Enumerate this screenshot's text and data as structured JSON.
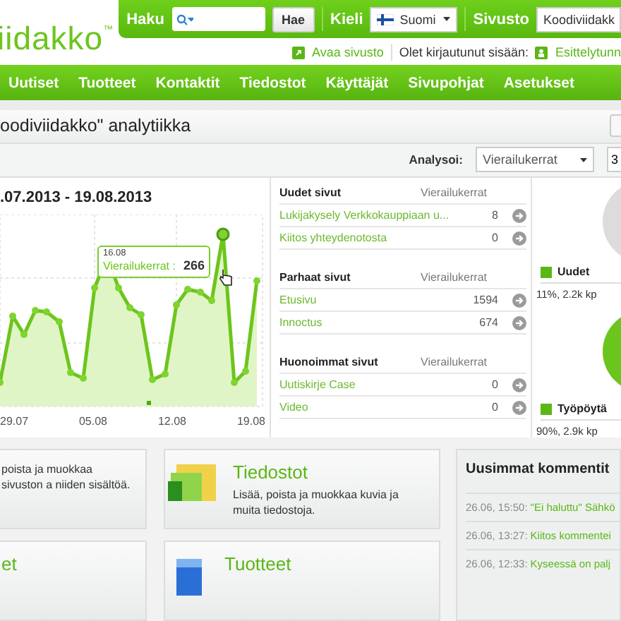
{
  "header": {
    "logo": "iidakko",
    "logo_mark": "™",
    "search_label": "Haku",
    "search_button": "Hae",
    "language_label": "Kieli",
    "language": "Suomi",
    "site_label": "Sivusto",
    "site": "Koodiviidakk",
    "open_site": "Avaa sivusto",
    "logged_in_label": "Olet kirjautunut sisään:",
    "user": "Esittelytunn"
  },
  "nav": [
    {
      "label": "Uutiset"
    },
    {
      "label": "Tuotteet"
    },
    {
      "label": "Kontaktit"
    },
    {
      "label": "Tiedostot"
    },
    {
      "label": "Käyttäjät"
    },
    {
      "label": "Sivupohjat"
    },
    {
      "label": "Asetukset"
    }
  ],
  "page_title": "oodiviidakko\" analytiikka",
  "toolbar": {
    "analyze_label": "Analysoi:",
    "metric": "Vierailukerrat",
    "range": "3"
  },
  "chart": {
    "date_range": ".07.2013 - 19.08.2013",
    "x_labels": [
      "29.07",
      "05.08",
      "12.08",
      "19.08"
    ],
    "tooltip": {
      "date": "16.08",
      "label": "Vierailukerrat :",
      "value": "266"
    }
  },
  "tables": [
    {
      "title": "Uudet sivut",
      "column": "Vierailukerrat",
      "rows": [
        {
          "name": "Lukijakysely Verkkokauppiaan u...",
          "value": "8"
        },
        {
          "name": "Kiitos yhteydenotosta",
          "value": "0"
        }
      ]
    },
    {
      "title": "Parhaat sivut",
      "column": "Vierailukerrat",
      "rows": [
        {
          "name": "Etusivu",
          "value": "1594"
        },
        {
          "name": "Innoctus",
          "value": "674"
        }
      ]
    },
    {
      "title": "Huonoimmat sivut",
      "column": "Vierailukerrat",
      "rows": [
        {
          "name": "Uutiskirje Case",
          "value": "0"
        },
        {
          "name": "Video",
          "value": "0"
        }
      ]
    }
  ],
  "segments": [
    {
      "label": "Uudet",
      "stats": "11%, 2.2k kp"
    },
    {
      "label": "Työpöytä",
      "stats": "90%, 2.9k kp"
    }
  ],
  "cards": [
    {
      "kind": "pages",
      "text": "poista ja muokkaa sivuston a niiden sisältöä."
    },
    {
      "kind": "files",
      "title": "Tiedostot",
      "text": "Lisää, poista ja muokkaa kuvia ja muita tiedostoja."
    },
    {
      "kind": "pages",
      "title": "et"
    },
    {
      "kind": "products",
      "title": "Tuotteet"
    }
  ],
  "comments": {
    "title": "Uusimmat kommentit",
    "items": [
      {
        "time": "26.06, 15:50:",
        "text": "\"Ei haluttu\" Sähkö"
      },
      {
        "time": "26.06, 13:27:",
        "text": "Kiitos kommentei"
      },
      {
        "time": "26.06, 12:33:",
        "text": "Kyseessä on palj"
      }
    ]
  }
}
